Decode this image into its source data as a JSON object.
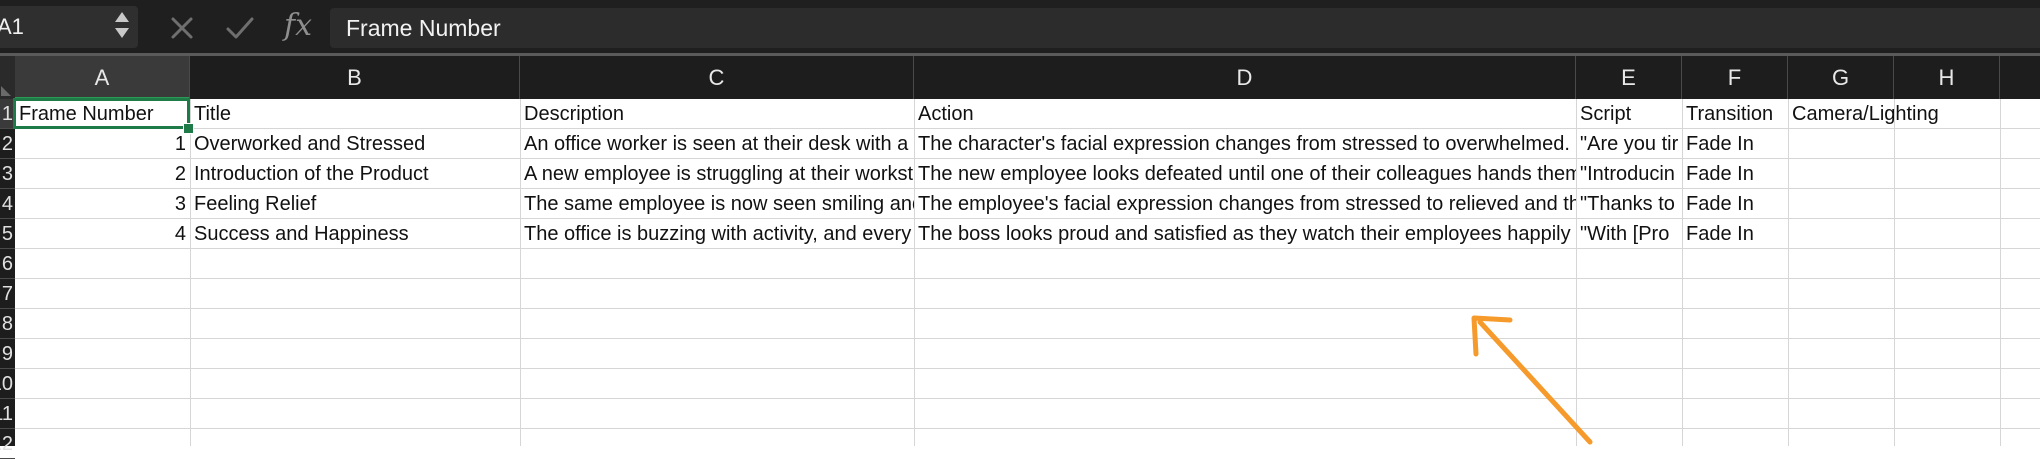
{
  "formula_bar": {
    "name_box": "A1",
    "formula": "Frame Number"
  },
  "columns": [
    "A",
    "B",
    "C",
    "D",
    "E",
    "F",
    "G",
    "H"
  ],
  "rows": [
    "1",
    "2",
    "3",
    "4",
    "5",
    "6",
    "7",
    "8",
    "9",
    "10",
    "11",
    "12"
  ],
  "sheet": {
    "headers": [
      "Frame Number",
      "Title",
      "Description",
      "Action",
      "Script",
      "Transition",
      "Camera/Lighting"
    ],
    "data": [
      [
        "1",
        "Overworked and Stressed",
        "An office worker is seen at their desk with a c",
        "The character's facial expression changes from stressed to overwhelmed. P",
        "\"Are you tir",
        "Fade In"
      ],
      [
        "2",
        "Introduction of the Product",
        "A new employee is struggling at their worksta",
        "The new employee looks defeated until one of their colleagues hands them",
        "\"Introducin",
        "Fade In"
      ],
      [
        "3",
        "Feeling Relief",
        "The same employee is now seen smiling and",
        "The employee's facial expression changes from stressed to relieved and the",
        "\"Thanks to",
        "Fade In"
      ],
      [
        "4",
        "Success and Happiness",
        "The office is buzzing with activity, and every",
        "The boss looks proud and satisfied as they watch their employees happily w",
        "\"With [Pro",
        "Fade In"
      ]
    ]
  },
  "colors": {
    "selection": "#1e7a46",
    "annotation_arrow": "#f59a2b",
    "toolbar_bg": "#1f1f1f"
  },
  "icons": {
    "cancel": "x-icon",
    "enter": "checkmark-icon",
    "function": "fx-icon"
  }
}
